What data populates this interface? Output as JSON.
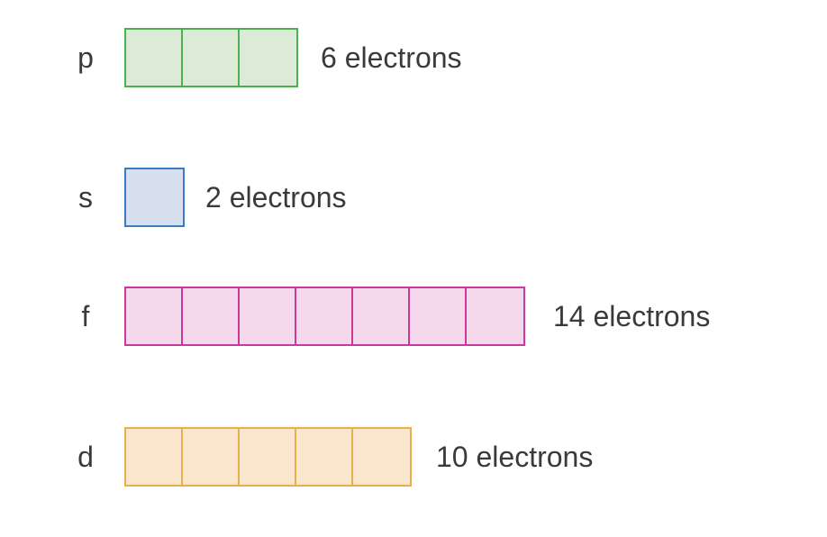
{
  "orbitals": [
    {
      "id": "p",
      "label": "p",
      "boxes": 3,
      "electrons_text": "6 electrons",
      "stroke": "#4caf50",
      "fill": "#dcebd8"
    },
    {
      "id": "s",
      "label": "s",
      "boxes": 1,
      "electrons_text": "2 electrons",
      "stroke": "#3a7cc0",
      "fill": "#d6e0ee"
    },
    {
      "id": "f",
      "label": "f",
      "boxes": 7,
      "electrons_text": "14 electrons",
      "stroke": "#c93a9b",
      "fill": "#f5d8eb"
    },
    {
      "id": "d",
      "label": "d",
      "boxes": 5,
      "electrons_text": "10 electrons",
      "stroke": "#e6b04e",
      "fill": "#fae6cd"
    }
  ]
}
